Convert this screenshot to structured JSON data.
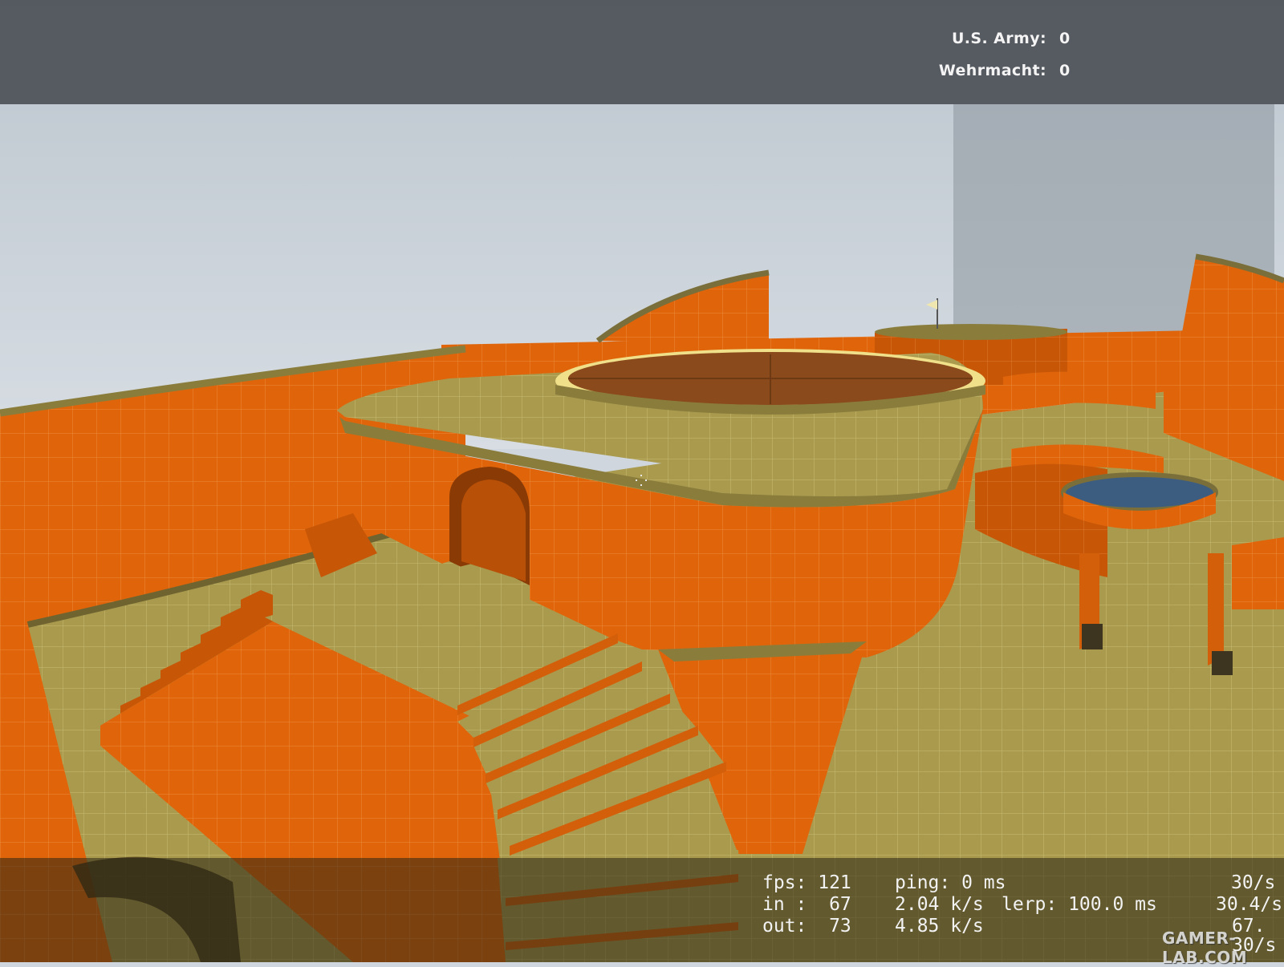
{
  "scoreboard": {
    "teams": [
      {
        "name": "U.S. Army:",
        "score": "0"
      },
      {
        "name": "Wehrmacht:",
        "score": "0"
      }
    ]
  },
  "netgraph": {
    "fps": "fps: 121",
    "ping": "ping: 0 ms",
    "rate_top": "30/s",
    "in": "in :  67",
    "in_rate": "2.04 k/s",
    "lerp": "lerp: 100.0 ms",
    "rate_mid": "30.4/s",
    "out": "out:  73",
    "out_rate": "4.85 k/s",
    "rate_bot": "67.",
    "rate_last": "30/s"
  },
  "watermark": "GAMER-LAB.COM",
  "colors": {
    "wall_orange": "#e0650a",
    "floor_olive": "#a99a4e",
    "sky": "#c9d0d8",
    "hud_bar": "#4e5258"
  }
}
